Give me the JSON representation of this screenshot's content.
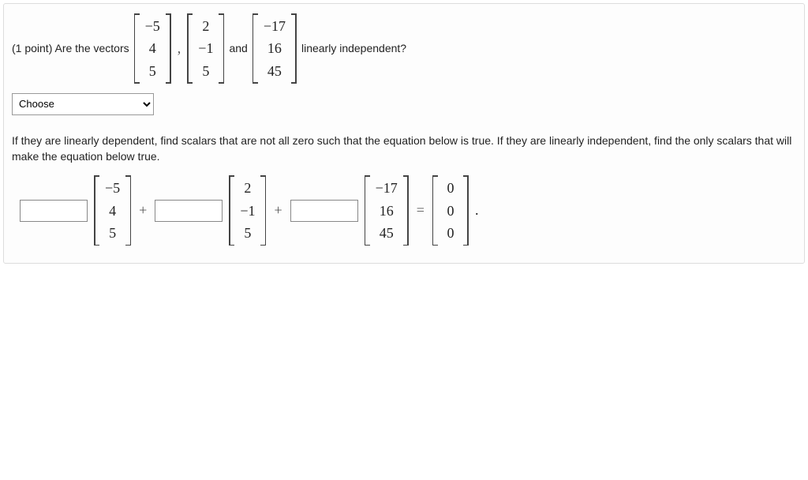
{
  "question": {
    "points_prefix": "(1 point) Are the vectors",
    "sep_comma": ",",
    "sep_and": "and",
    "suffix": "linearly independent?",
    "vectors": {
      "v1": [
        "−5",
        "4",
        "5"
      ],
      "v2": [
        "2",
        "−1",
        "5"
      ],
      "v3": [
        "−17",
        "16",
        "45"
      ]
    },
    "select_placeholder": "Choose"
  },
  "instructions": "If they are linearly dependent, find scalars that are not all zero such that the equation below is true. If they are linearly independent, find the only scalars that will make the equation below true.",
  "equation": {
    "plus": "+",
    "equals": "=",
    "period": ".",
    "vectors": {
      "v1": [
        "−5",
        "4",
        "5"
      ],
      "v2": [
        "2",
        "−1",
        "5"
      ],
      "v3": [
        "−17",
        "16",
        "45"
      ],
      "zero": [
        "0",
        "0",
        "0"
      ]
    }
  }
}
